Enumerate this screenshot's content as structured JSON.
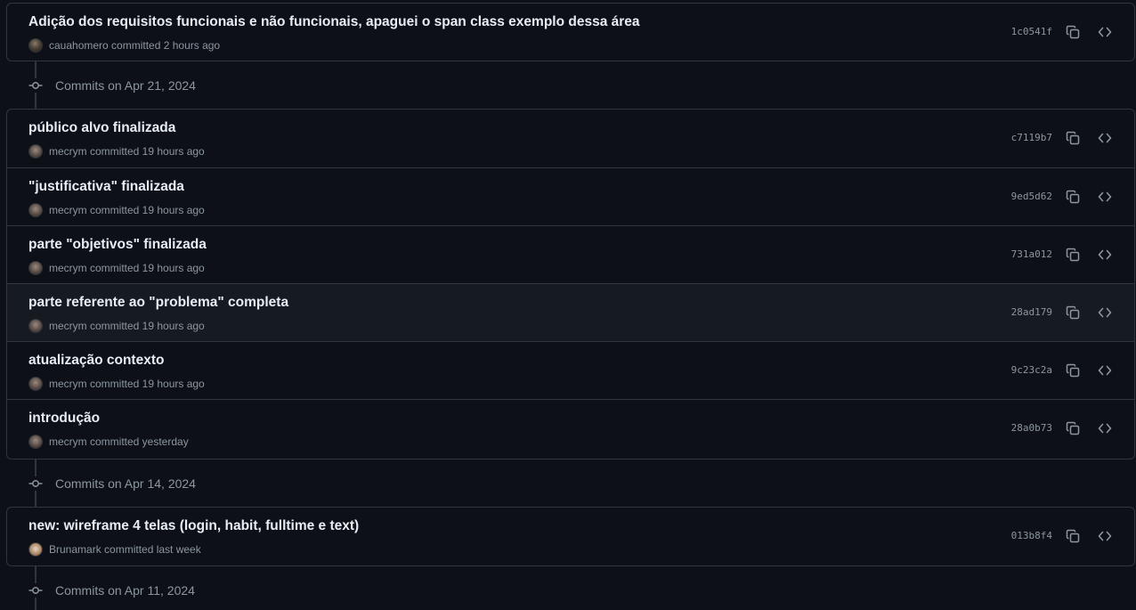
{
  "commit_groups": [
    {
      "date_label": "",
      "commits": [
        {
          "message": "Adição dos requisitos funcionais e não funcionais, apaguei o span class exemplo dessa área",
          "author_line": "cauahomero committed 2 hours ago",
          "sha": "1c0541f"
        }
      ]
    },
    {
      "date_label": "Commits on Apr 21, 2024",
      "commits": [
        {
          "message": "público alvo finalizada",
          "author_line": "mecrym committed 19 hours ago",
          "sha": "c7119b7"
        },
        {
          "message": "\"justificativa\" finalizada",
          "author_line": "mecrym committed 19 hours ago",
          "sha": "9ed5d62"
        },
        {
          "message": "parte \"objetivos\" finalizada",
          "author_line": "mecrym committed 19 hours ago",
          "sha": "731a012"
        },
        {
          "message": "parte referente ao \"problema\" completa",
          "author_line": "mecrym committed 19 hours ago",
          "sha": "28ad179"
        },
        {
          "message": "atualização contexto",
          "author_line": "mecrym committed 19 hours ago",
          "sha": "9c23c2a"
        },
        {
          "message": "introdução",
          "author_line": "mecrym committed yesterday",
          "sha": "28a0b73"
        }
      ]
    },
    {
      "date_label": "Commits on Apr 14, 2024",
      "commits": [
        {
          "message": "new: wireframe 4 telas (login, habit, fulltime e text)",
          "author_line": "Brunamark committed last week",
          "sha": "013b8f4"
        }
      ]
    },
    {
      "date_label": "Commits on Apr 11, 2024",
      "commits": []
    }
  ],
  "icons": {
    "copy": "copy-icon",
    "browse": "code-icon",
    "timeline": "git-commit-icon"
  },
  "colors": {
    "background": "#0d1117",
    "border": "#30363d",
    "text": "#e6edf3",
    "muted": "#8d96a0"
  }
}
